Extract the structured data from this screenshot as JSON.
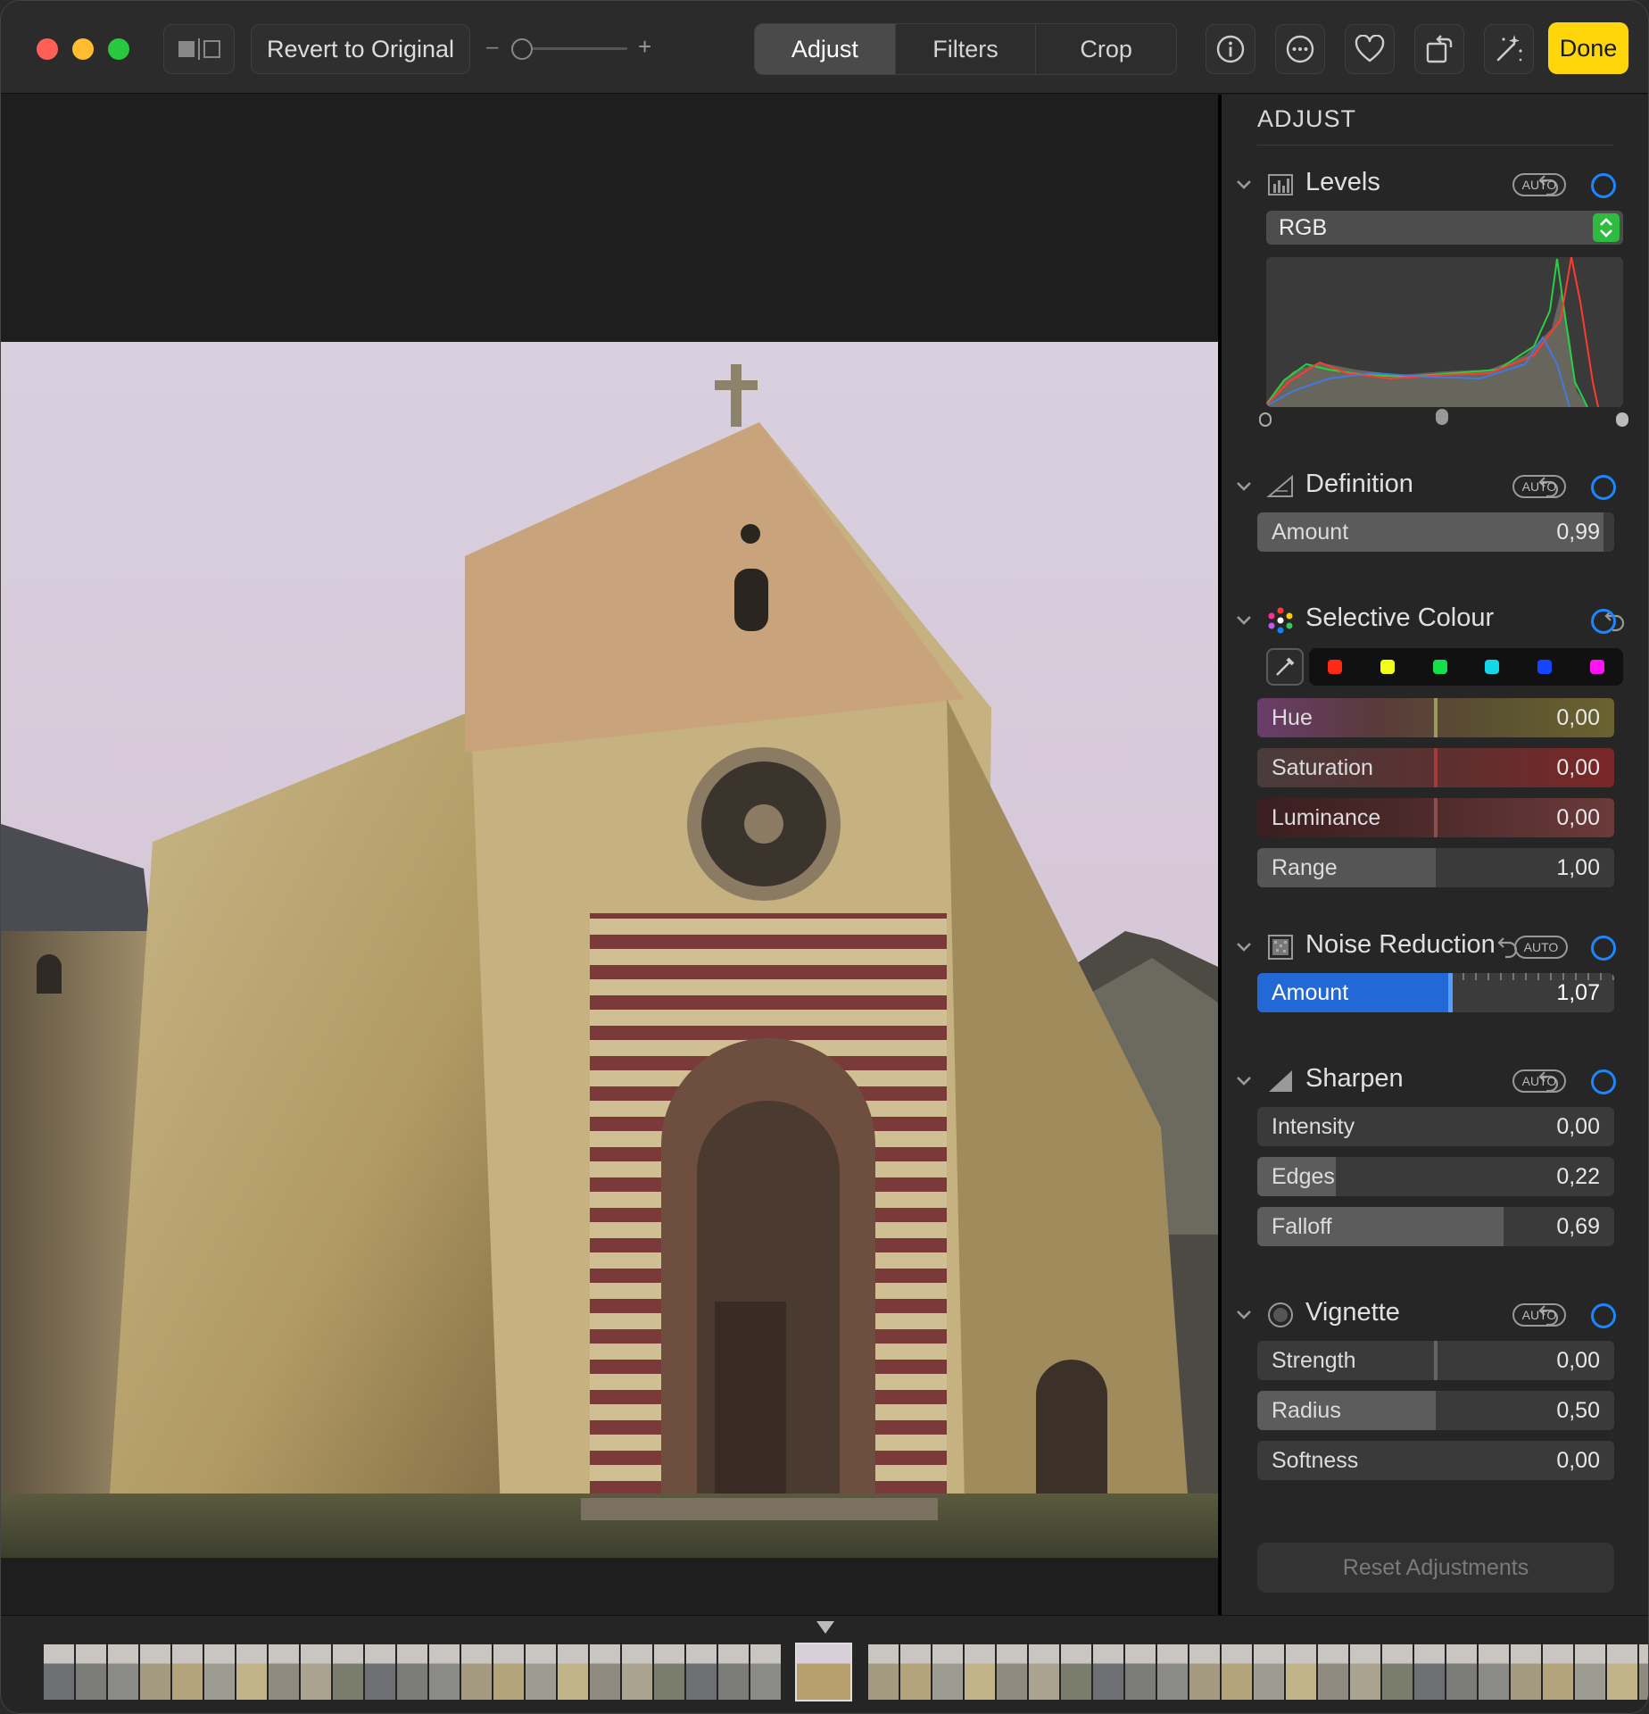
{
  "toolbar": {
    "revert_label": "Revert to Original",
    "zoom_minus": "–",
    "zoom_plus": "+",
    "tabs": [
      {
        "label": "Adjust",
        "selected": true
      },
      {
        "label": "Filters",
        "selected": false
      },
      {
        "label": "Crop",
        "selected": false
      }
    ],
    "icons": [
      "info-icon",
      "more-icon",
      "heart-icon",
      "rotate-icon",
      "magic-wand-icon"
    ],
    "done_label": "Done"
  },
  "sidebar": {
    "title": "ADJUST",
    "levels": {
      "title": "Levels",
      "auto": "AUTO",
      "channel": "RGB"
    },
    "definition": {
      "title": "Definition",
      "auto": "AUTO",
      "amount_label": "Amount",
      "amount_value": "0,99",
      "amount": 0.99
    },
    "selective_colour": {
      "title": "Selective Colour",
      "swatches": [
        "#ff2a14",
        "#f2ff14",
        "#14e04a",
        "#13d7e6",
        "#1446ff",
        "#ff14f5"
      ],
      "hue_label": "Hue",
      "hue_value": "0,00",
      "saturation_label": "Saturation",
      "saturation_value": "0,00",
      "luminance_label": "Luminance",
      "luminance_value": "0,00",
      "range_label": "Range",
      "range_value": "1,00"
    },
    "noise_reduction": {
      "title": "Noise Reduction",
      "auto": "AUTO",
      "amount_label": "Amount",
      "amount_value": "1,07"
    },
    "sharpen": {
      "title": "Sharpen",
      "auto": "AUTO",
      "intensity_label": "Intensity",
      "intensity_value": "0,00",
      "edges_label": "Edges",
      "edges_value": "0,22",
      "falloff_label": "Falloff",
      "falloff_value": "0,69"
    },
    "vignette": {
      "title": "Vignette",
      "auto": "AUTO",
      "strength_label": "Strength",
      "strength_value": "0,00",
      "radius_label": "Radius",
      "radius_value": "0,50",
      "softness_label": "Softness",
      "softness_value": "0,00"
    },
    "reset_label": "Reset Adjustments"
  },
  "colors": {
    "accent": "#1c86ff",
    "done": "#ffd60a",
    "close": "#ff5f57",
    "minimize": "#febc2e",
    "zoom": "#28c840"
  }
}
